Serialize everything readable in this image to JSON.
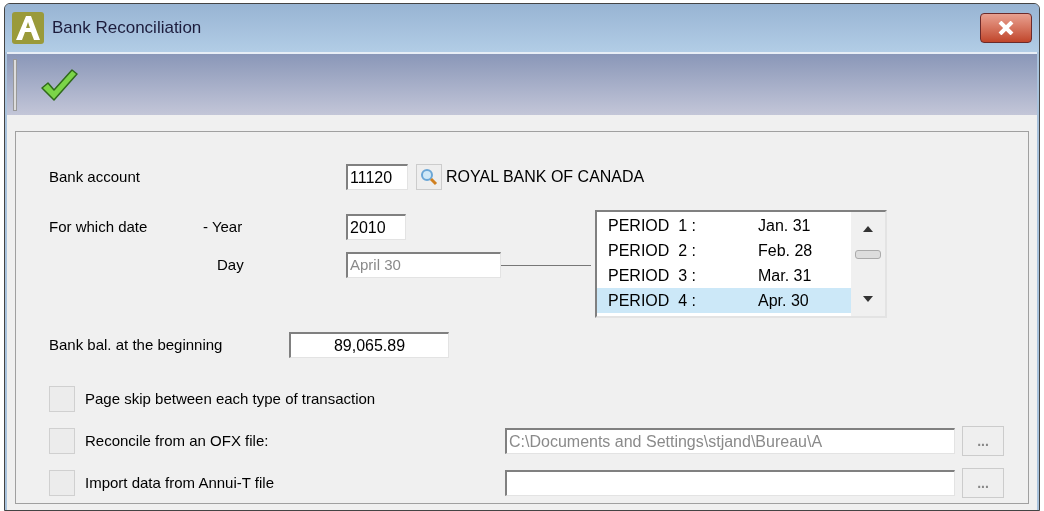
{
  "window": {
    "title": "Bank Reconciliation"
  },
  "bank_account": {
    "label": "Bank account",
    "value": "11120",
    "name": "ROYAL BANK OF CANADA"
  },
  "date": {
    "label": "For which date",
    "year_label": "- Year",
    "year": "2010",
    "day_label": "Day",
    "day": "April 30",
    "day_disabled": true
  },
  "periods": [
    {
      "label": "PERIOD  1 :",
      "date": "Jan. 31",
      "selected": false
    },
    {
      "label": "PERIOD  2 :",
      "date": "Feb. 28",
      "selected": false
    },
    {
      "label": "PERIOD  3 :",
      "date": "Mar. 31",
      "selected": false
    },
    {
      "label": "PERIOD  4 :",
      "date": "Apr. 30",
      "selected": true
    }
  ],
  "balance": {
    "label": "Bank bal. at the beginning",
    "value": "89,065.89"
  },
  "options": [
    {
      "label": "Page skip between each type of transaction",
      "checked": false,
      "kind": "plain"
    },
    {
      "label": "Reconcile from an OFX file:",
      "checked": false,
      "kind": "file",
      "path": "C:\\Documents and Settings\\stjand\\Bureau\\A",
      "disabled": true,
      "browse": "..."
    },
    {
      "label": "Import data from Annui-T file",
      "checked": false,
      "kind": "file",
      "browse": "..."
    }
  ]
}
